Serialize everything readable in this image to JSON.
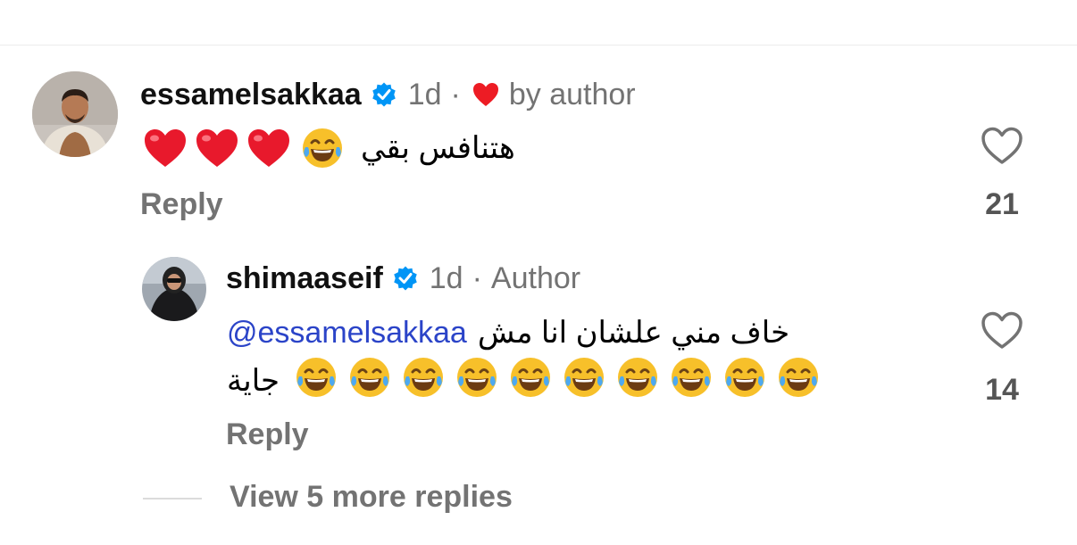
{
  "comments": [
    {
      "username": "essamelsakkaa",
      "time": "1d",
      "separator": "·",
      "liked_label": "by author",
      "text": "هتنافس بقي",
      "reply_label": "Reply",
      "like_count": "21"
    }
  ],
  "reply_comment": {
    "username": "shimaaseif",
    "time": "1d",
    "separator": "·",
    "role": "Author",
    "mention": "@essamelsakkaa",
    "text_line1": "خاف مني علشان انا مش",
    "text_line2": "جاية",
    "reply_label": "Reply",
    "like_count": "14"
  },
  "view_more": "View 5 more replies",
  "colors": {
    "verified": "#0095f6",
    "heart_red": "#ed1c24",
    "meta_gray": "#737373",
    "mention_blue": "#2b44c8"
  }
}
